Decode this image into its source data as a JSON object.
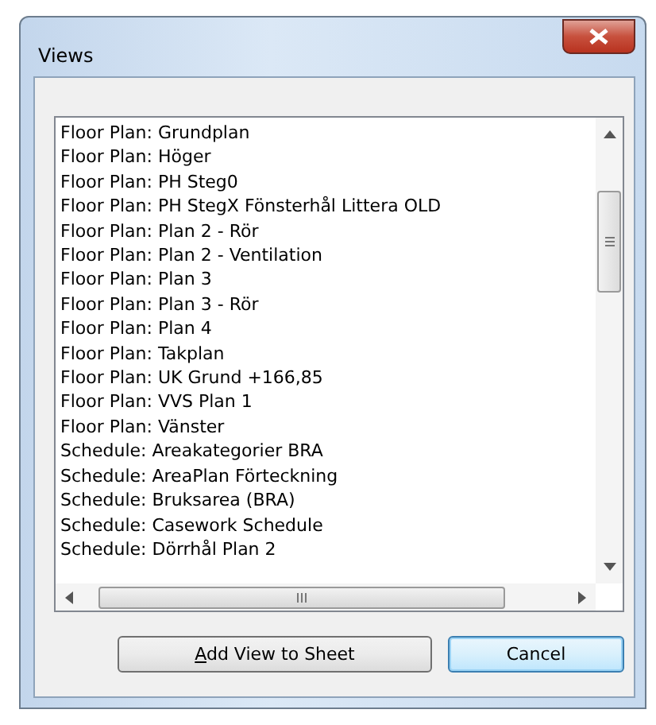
{
  "window": {
    "title": "Views"
  },
  "views": {
    "items": [
      "Floor Plan: Grundplan",
      "Floor Plan: Höger",
      "Floor Plan: PH Steg0",
      "Floor Plan: PH StegX Fönsterhål Littera OLD",
      "Floor Plan: Plan 2 - Rör",
      "Floor Plan: Plan 2 - Ventilation",
      "Floor Plan: Plan 3",
      "Floor Plan: Plan 3 - Rör",
      "Floor Plan: Plan 4",
      "Floor Plan: Takplan",
      "Floor Plan: UK Grund +166,85",
      "Floor Plan: VVS Plan 1",
      "Floor Plan: Vänster",
      "Schedule: Areakategorier BRA",
      "Schedule: AreaPlan Förteckning",
      "Schedule: Bruksarea (BRA)",
      "Schedule: Casework Schedule",
      "Schedule: Dörrhål Plan 2"
    ]
  },
  "buttons": [
    {
      "label": "Add View to Sheet",
      "first_letter_underlined": true,
      "default": false
    },
    {
      "label": "Cancel",
      "default": true
    }
  ]
}
